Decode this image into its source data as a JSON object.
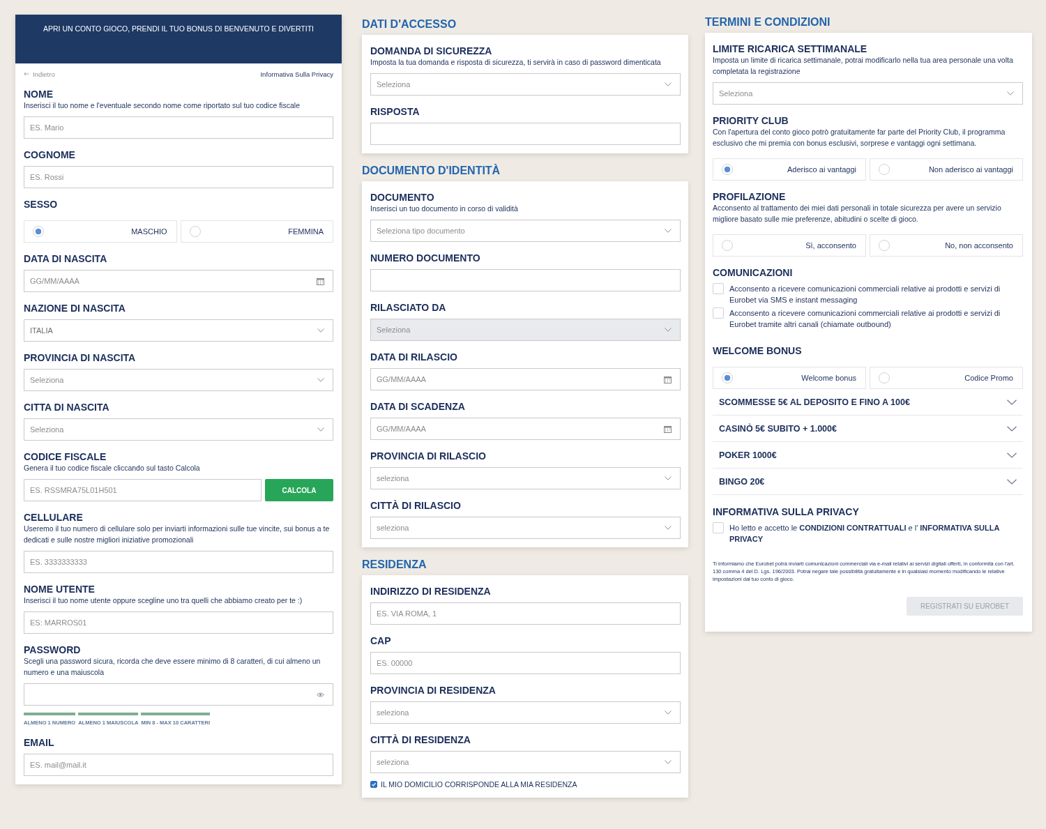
{
  "account_panel": {
    "banner": "APRI UN CONTO GIOCO, PRENDI IL TUO BONUS DI BENVENUTO E DIVERTITI",
    "back_link": "Indietro",
    "privacy_link": "Informativa Sulla Privacy",
    "fields": [
      {
        "kind": "text",
        "label": "NOME",
        "description": "Inserisci il tuo nome e l'eventuale secondo nome come riportato sul tuo codice fiscale",
        "placeholder": "ES. Mario"
      },
      {
        "kind": "text",
        "label": "COGNOME",
        "placeholder": "ES. Rossi"
      },
      {
        "kind": "radio",
        "label": "SESSO",
        "options": [
          {
            "label": "MASCHIO",
            "selected": true
          },
          {
            "label": "FEMMINA",
            "selected": false
          }
        ]
      },
      {
        "kind": "date",
        "label": "DATA DI NASCITA",
        "placeholder": "GG/MM/AAAA"
      },
      {
        "kind": "select",
        "label": "NAZIONE DI NASCITA",
        "value": "ITALIA"
      },
      {
        "kind": "select",
        "label": "PROVINCIA DI NASCITA",
        "placeholder": "Seleziona"
      },
      {
        "kind": "select",
        "label": "CITTA DI NASCITA",
        "placeholder": "Seleziona"
      },
      {
        "kind": "text_button",
        "label": "CODICE FISCALE",
        "description": "Genera il tuo codice fiscale cliccando sul tasto Calcola",
        "placeholder": "ES. RSSMRA75L01H501",
        "button": "CALCOLA"
      },
      {
        "kind": "text",
        "label": "CELLULARE",
        "description": "Useremo il tuo numero di cellulare solo per inviarti informazioni sulle tue vincite, sui bonus a te dedicati e sulle nostre migliori iniziative promozionali",
        "placeholder": "ES. 3333333333"
      },
      {
        "kind": "text",
        "label": "NOME UTENTE",
        "description": "Inserisci il tuo nome utente oppure scegline uno tra quelli che abbiamo creato per te :)",
        "placeholder": "ES: MARROS01"
      },
      {
        "kind": "password",
        "label": "PASSWORD",
        "description": "Scegli una password sicura, ricorda che deve essere minimo di 8 caratteri, di cui almeno un numero e una maiuscola",
        "rules": [
          "ALMENO 1 NUMERO",
          "ALMENO 1 MAIUSCOLA",
          "MIN 8 - MAX 10 CARATTERI"
        ]
      },
      {
        "kind": "text",
        "label": "EMAIL",
        "placeholder": "ES. mail@mail.it"
      }
    ]
  },
  "access_sections": [
    {
      "title": "DATI D'ACCESSO",
      "fields": [
        {
          "kind": "select",
          "label": "DOMANDA DI SICUREZZA",
          "description": "Imposta la tua domanda e risposta di sicurezza, ti servirà in caso di password dimenticata",
          "placeholder": "Seleziona"
        },
        {
          "kind": "text",
          "label": "RISPOSTA"
        }
      ]
    },
    {
      "title": "DOCUMENTO D'IDENTITÀ",
      "fields": [
        {
          "kind": "select",
          "label": "DOCUMENTO",
          "description": "Inserisci un tuo documento in corso di validità",
          "placeholder": "Seleziona tipo documento",
          "disabled": false
        },
        {
          "kind": "text",
          "label": "NUMERO DOCUMENTO",
          "disabled": false
        },
        {
          "kind": "select",
          "label": "RILASCIATO DA",
          "placeholder": "Seleziona",
          "disabled": true
        },
        {
          "kind": "date",
          "label": "DATA DI RILASCIO",
          "placeholder": "GG/MM/AAAA",
          "disabled": false
        },
        {
          "kind": "date",
          "label": "DATA DI SCADENZA",
          "placeholder": "GG/MM/AAAA",
          "disabled": false
        },
        {
          "kind": "select",
          "label": "PROVINCIA DI RILASCIO",
          "placeholder": "seleziona",
          "disabled": false
        },
        {
          "kind": "select",
          "label": "CITTÀ DI RILASCIO",
          "placeholder": "seleziona",
          "disabled": false
        }
      ]
    },
    {
      "title": "RESIDENZA",
      "fields": [
        {
          "kind": "text",
          "label": "INDIRIZZO DI RESIDENZA",
          "placeholder": "ES. VIA ROMA, 1"
        },
        {
          "kind": "text",
          "label": "CAP",
          "placeholder": "ES. 00000"
        },
        {
          "kind": "select",
          "label": "PROVINCIA DI RESIDENZA",
          "placeholder": "seleziona"
        },
        {
          "kind": "select",
          "label": "CITTÀ DI RESIDENZA",
          "placeholder": "seleziona"
        },
        {
          "kind": "checkbox",
          "label": "IL MIO DOMICILIO CORRISPONDE ALLA MIA RESIDENZA",
          "checked": true
        }
      ]
    }
  ],
  "terms_panel": {
    "title": "TERMINI E CONDIZIONI",
    "fields": [
      {
        "kind": "select",
        "label": "LIMITE RICARICA SETTIMANALE",
        "description": "Imposta un limite di ricarica settimanale, potrai modificarlo nella tua area personale una volta completata la registrazione",
        "placeholder": "Seleziona"
      },
      {
        "kind": "radio",
        "label": "PRIORITY CLUB",
        "description": "Con l'apertura del conto gioco potrò gratuitamente far parte del Priority Club, il programma esclusivo che mi premia con bonus esclusivi, sorprese e vantaggi ogni settimana.",
        "options": [
          {
            "label": "Aderisco ai vantaggi",
            "selected": true
          },
          {
            "label": "Non aderisco ai vantaggi",
            "selected": false
          }
        ]
      },
      {
        "kind": "radio",
        "label": "PROFILAZIONE",
        "description": "Acconsento al trattamento dei miei dati personali in totale sicurezza per avere un servizio migliore basato sulle mie preferenze, abitudini o scelte di gioco.",
        "options": [
          {
            "label": "Sì, acconsento",
            "selected": false
          },
          {
            "label": "No, non acconsento",
            "selected": false
          }
        ]
      },
      {
        "kind": "checkboxes",
        "label": "COMUNICAZIONI",
        "options": [
          {
            "label": "Acconsento a ricevere comunicazioni commerciali relative ai prodotti e servizi di Eurobet via SMS e instant messaging",
            "checked": false
          },
          {
            "label": "Acconsento a ricevere comunicazioni commerciali relative ai prodotti e servizi di Eurobet tramite altri canali (chiamate outbound)",
            "checked": false
          }
        ]
      },
      {
        "kind": "radio",
        "label": "WELCOME BONUS",
        "options": [
          {
            "label": "Welcome bonus",
            "selected": true
          },
          {
            "label": "Codice Promo",
            "selected": false
          }
        ],
        "offers": [
          {
            "label": "SCOMMESSE 5€ AL DEPOSITO E FINO A 100€",
            "expanded": false
          },
          {
            "label": "CASINÒ 5€ SUBITO + 1.000€",
            "expanded": false
          },
          {
            "label": "POKER 1000€",
            "expanded": false
          },
          {
            "label": "BINGO 20€",
            "expanded": false
          }
        ]
      },
      {
        "kind": "checkboxes",
        "label": "INFORMATIVA SULLA PRIVACY",
        "options": [
          {
            "label": "Ho letto e accetto le **CONDIZIONI CONTRATTUALI** e l' **INFORMATIVA SULLA PRIVACY**",
            "checked": false
          }
        ]
      }
    ],
    "notice": "Ti informiamo che Eurobet potrà inviarti comunicazioni commerciali via e-mail relativi ai servizi digitali offerti, in conformità con l'art. 130 comma 4 del D. Lgs. 196/2003. Potrai negare tale possibilità gratuitamente e in qualsiasi momento modificando le relative impostazioni dal tuo conto di gioco.",
    "submit": {
      "label": "REGISTRATI SU EUROBET",
      "disabled": true
    }
  }
}
